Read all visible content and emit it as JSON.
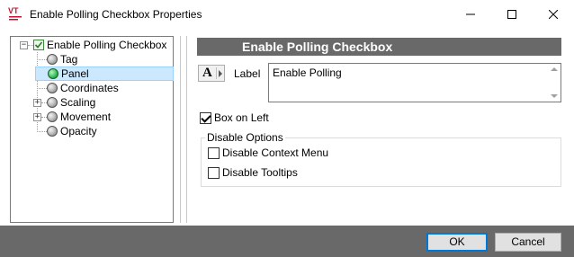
{
  "window": {
    "logo_text": "VT",
    "title": "Enable Polling Checkbox Properties"
  },
  "tree": {
    "root": {
      "label": "Enable Polling Checkbox",
      "expander": "−"
    },
    "items": [
      {
        "label": "Tag",
        "icon": "gray-ball-icon",
        "expander": ""
      },
      {
        "label": "Panel",
        "icon": "green-ball-icon",
        "expander": "",
        "selected": true
      },
      {
        "label": "Coordinates",
        "icon": "gray-ball-icon",
        "expander": ""
      },
      {
        "label": "Scaling",
        "icon": "gray-ball-icon",
        "expander": "+"
      },
      {
        "label": "Movement",
        "icon": "gray-ball-icon",
        "expander": "+"
      },
      {
        "label": "Opacity",
        "icon": "gray-ball-icon",
        "expander": ""
      }
    ]
  },
  "panel": {
    "header": "Enable Polling Checkbox",
    "font_button_letter": "A",
    "label_caption": "Label",
    "label_value": "Enable Polling",
    "box_on_left": {
      "label": "Box on Left",
      "checked": true
    },
    "disable_options": {
      "title": "Disable Options",
      "context_menu": {
        "label": "Disable Context Menu",
        "checked": false
      },
      "tooltips": {
        "label": "Disable Tooltips",
        "checked": false
      }
    }
  },
  "buttons": {
    "ok": "OK",
    "cancel": "Cancel"
  },
  "colors": {
    "header_bg": "#696969",
    "bottom_bar_bg": "#696969",
    "selection_bg": "#cce8ff",
    "ok_border": "#0078d7",
    "logo_red": "#c8102e"
  }
}
